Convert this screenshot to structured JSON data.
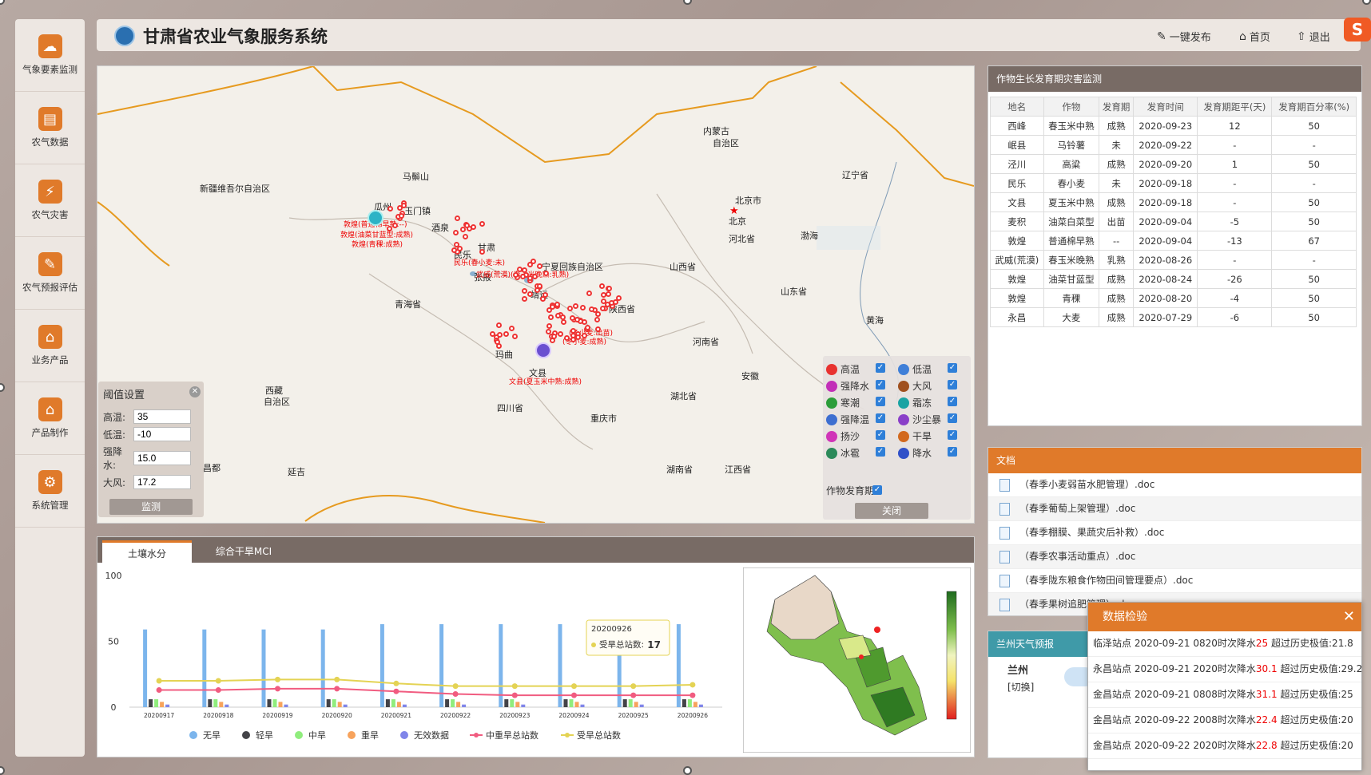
{
  "header": {
    "title": "甘肃省农业气象服务系统",
    "publish": "一键发布",
    "home": "首页",
    "logout": "退出"
  },
  "sidebar": {
    "items": [
      {
        "label": "气象要素监测",
        "icon": "cloud-icon"
      },
      {
        "label": "农气数据",
        "icon": "database-icon"
      },
      {
        "label": "农气灾害",
        "icon": "lightning-icon"
      },
      {
        "label": "农气预报评估",
        "icon": "report-icon"
      },
      {
        "label": "业务产品",
        "icon": "house-icon"
      },
      {
        "label": "产品制作",
        "icon": "house-icon"
      },
      {
        "label": "系统管理",
        "icon": "gear-icon"
      }
    ]
  },
  "map": {
    "labels": [
      "新疆维吾尔自治区",
      "内蒙古",
      "自治区",
      "北京市",
      "北京",
      "河北省",
      "辽宁省",
      "渤海",
      "宁夏回族自治区",
      "山西省",
      "山东省",
      "青海省",
      "陕西省",
      "河南省",
      "黄海",
      "西藏",
      "自治区",
      "四川省",
      "湖北省",
      "重庆市",
      "安徽",
      "湖南省",
      "江西省",
      "马鬃山",
      "玉门镇",
      "酒泉",
      "瓜州",
      "民乐",
      "甘肃",
      "靖远",
      "文县",
      "张掖",
      "玛曲",
      "昌都",
      "延吉"
    ],
    "red_labels": [
      "敦煌(普通棉早熟:--)",
      "敦煌(油菜甘蓝型:成熟)",
      "敦煌(青稞:成熟)",
      "民乐(春小麦:未)",
      "武威(荒漠)(春玉米晚熟:乳熟)",
      "(冬小麦:出苗)",
      "(冬小麦:成熟)",
      "文县(夏玉米中熟:成熟)"
    ]
  },
  "threshold": {
    "title": "阈值设置",
    "fields": [
      {
        "label": "高温:",
        "value": "35"
      },
      {
        "label": "低温:",
        "value": "-10"
      },
      {
        "label": "强降水:",
        "value": "15.0"
      },
      {
        "label": "大风:",
        "value": "17.2"
      }
    ],
    "button": "监测"
  },
  "legend": {
    "items": [
      {
        "label": "高温",
        "color": "#e8322f"
      },
      {
        "label": "低温",
        "color": "#3f7fd8"
      },
      {
        "label": "强降水",
        "color": "#c22fb8"
      },
      {
        "label": "大风",
        "color": "#a0501e"
      },
      {
        "label": "寒潮",
        "color": "#2c9d3a"
      },
      {
        "label": "霜冻",
        "color": "#1aa3a3"
      },
      {
        "label": "强降温",
        "color": "#3d6ed0"
      },
      {
        "label": "沙尘暴",
        "color": "#8a3fc8"
      },
      {
        "label": "扬沙",
        "color": "#d035b8"
      },
      {
        "label": "干旱",
        "color": "#d2691e"
      },
      {
        "label": "冰雹",
        "color": "#2c8a5a"
      },
      {
        "label": "降水",
        "color": "#3050c8"
      }
    ],
    "growth": "作物发育期",
    "button": "关闭"
  },
  "tabs": {
    "soil": "土壤水分",
    "mci": "综合干旱MCI"
  },
  "chart_data": {
    "type": "bar",
    "categories": [
      "20200917",
      "20200918",
      "20200919",
      "20200920",
      "20200921",
      "20200922",
      "20200923",
      "20200924",
      "20200925",
      "20200926"
    ],
    "ylim": [
      0,
      100
    ],
    "yticks": [
      "100",
      "50",
      "0"
    ],
    "series": [
      {
        "name": "无旱",
        "type": "bar",
        "color": "#7cb5ec",
        "values": [
          59,
          59,
          59,
          59,
          63,
          63,
          63,
          63,
          63,
          63
        ]
      },
      {
        "name": "轻旱",
        "type": "bar",
        "color": "#434348",
        "values": [
          6,
          6,
          6,
          6,
          6,
          6,
          6,
          6,
          6,
          6
        ]
      },
      {
        "name": "中旱",
        "type": "bar",
        "color": "#90ed7d",
        "values": [
          6,
          6,
          6,
          6,
          6,
          6,
          6,
          6,
          6,
          6
        ]
      },
      {
        "name": "重旱",
        "type": "bar",
        "color": "#f7a35c",
        "values": [
          4,
          4,
          4,
          4,
          4,
          4,
          4,
          4,
          4,
          4
        ]
      },
      {
        "name": "无效数据",
        "type": "bar",
        "color": "#8085e9",
        "values": [
          2,
          2,
          2,
          2,
          2,
          2,
          2,
          2,
          2,
          2
        ]
      },
      {
        "name": "中重旱总站数",
        "type": "line",
        "color": "#f15c80",
        "values": [
          13,
          13,
          14,
          14,
          12,
          10,
          9,
          9,
          9,
          9
        ]
      },
      {
        "name": "受旱总站数",
        "type": "line",
        "color": "#e4d354",
        "values": [
          20,
          20,
          21,
          21,
          18,
          16,
          16,
          16,
          16,
          17
        ]
      }
    ],
    "tooltip": {
      "date": "20200926",
      "label": "受旱总站数:",
      "value": "17"
    }
  },
  "crop": {
    "title": "作物生长发育期灾害监测",
    "headers": [
      "地名",
      "作物",
      "发育期",
      "发育时间",
      "发育期距平(天)",
      "发育期百分率(%)"
    ],
    "rows": [
      [
        "西峰",
        "春玉米中熟",
        "成熟",
        "2020-09-23",
        "12",
        "50"
      ],
      [
        "岷县",
        "马铃薯",
        "未",
        "2020-09-22",
        "-",
        "-"
      ],
      [
        "泾川",
        "高粱",
        "成熟",
        "2020-09-20",
        "1",
        "50"
      ],
      [
        "民乐",
        "春小麦",
        "未",
        "2020-09-18",
        "-",
        "-"
      ],
      [
        "文县",
        "夏玉米中熟",
        "成熟",
        "2020-09-18",
        "-",
        "50"
      ],
      [
        "麦积",
        "油菜白菜型",
        "出苗",
        "2020-09-04",
        "-5",
        "50"
      ],
      [
        "敦煌",
        "普通棉早熟",
        "--",
        "2020-09-04",
        "-13",
        "67"
      ],
      [
        "武威(荒漠)",
        "春玉米晚熟",
        "乳熟",
        "2020-08-26",
        "-",
        "-"
      ],
      [
        "敦煌",
        "油菜甘蓝型",
        "成熟",
        "2020-08-24",
        "-26",
        "50"
      ],
      [
        "敦煌",
        "青稞",
        "成熟",
        "2020-08-20",
        "-4",
        "50"
      ],
      [
        "永昌",
        "大麦",
        "成熟",
        "2020-07-29",
        "-6",
        "50"
      ]
    ]
  },
  "docs": {
    "title": "文档",
    "items": [
      "（春季小麦弱苗水肥管理）.doc",
      "（春季葡萄上架管理）.doc",
      "（春季棚膜、果蔬灾后补救）.doc",
      "（春季农事活动重点）.doc",
      "（春季陇东粮食作物田间管理要点）.doc",
      "（春季果树追肥管理）.doc"
    ]
  },
  "weather": {
    "title": "兰州天气预报",
    "city": "兰州",
    "switch": "[切换]"
  },
  "alert": {
    "title": "数据检验",
    "rows": [
      {
        "pre": "临泽站点 2020-09-21 0820时次降水",
        "num": "25",
        "post": " 超过历史极值:21.8"
      },
      {
        "pre": "永昌站点 2020-09-21 2020时次降水",
        "num": "30.1",
        "post": " 超过历史极值:29.2"
      },
      {
        "pre": "金昌站点 2020-09-21 0808时次降水",
        "num": "31.1",
        "post": " 超过历史极值:25"
      },
      {
        "pre": "金昌站点 2020-09-22 2008时次降水",
        "num": "22.4",
        "post": " 超过历史极值:20"
      },
      {
        "pre": "金昌站点 2020-09-22 2020时次降水",
        "num": "22.8",
        "post": " 超过历史极值:20"
      }
    ]
  }
}
